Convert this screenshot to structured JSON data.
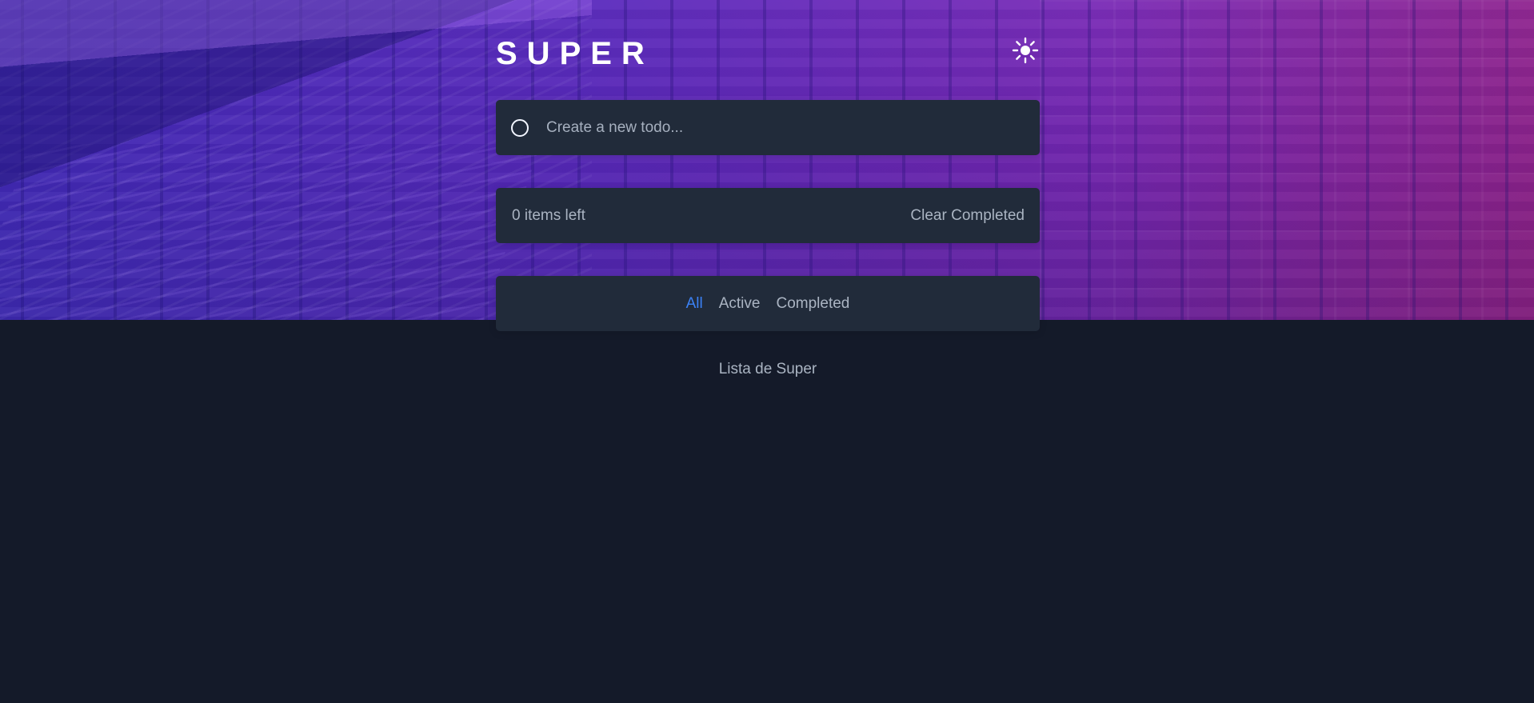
{
  "header": {
    "title": "SUPER",
    "theme_icon": "sun-icon"
  },
  "create": {
    "placeholder": "Create a new todo...",
    "value": ""
  },
  "summary": {
    "items_left": "0 items left",
    "clear_completed": "Clear Completed"
  },
  "filters": [
    {
      "label": "All",
      "active": true
    },
    {
      "label": "Active",
      "active": false
    },
    {
      "label": "Completed",
      "active": false
    }
  ],
  "footer": {
    "text": "Lista de Super"
  },
  "colors": {
    "page_background": "#141a29",
    "card_background": "#212b3a",
    "muted_text": "#aab4c2",
    "active_filter": "#3b82f6",
    "title_text": "#ffffff"
  }
}
